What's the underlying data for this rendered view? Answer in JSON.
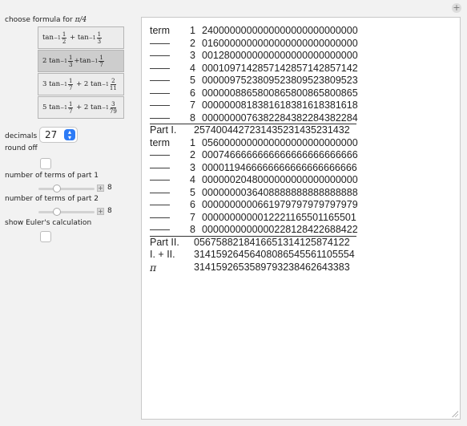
{
  "controls": {
    "choose_formula_label": "choose formula for ",
    "choose_formula_pi": "π/4",
    "formulas": [
      {
        "c1": "",
        "a1": "1",
        "b1": "2",
        "c2": "",
        "a2": "1",
        "b2": "3"
      },
      {
        "c1": "2",
        "a1": "1",
        "b1": "3",
        "c2": "",
        "a2": "1",
        "b2": "7"
      },
      {
        "c1": "3",
        "a1": "1",
        "b1": "7",
        "c2": "2",
        "a2": "2",
        "b2": "11"
      },
      {
        "c1": "5",
        "a1": "1",
        "b1": "7",
        "c2": "2",
        "a2": "3",
        "b2": "79"
      }
    ],
    "selected_formula": 1,
    "decimals_label": "decimals",
    "decimals_value": "27",
    "round_off_label": "round off",
    "part1_label": "number of terms of part 1",
    "part1_value": "8",
    "part1_fraction": 0.3,
    "part2_label": "number of terms of part 2",
    "part2_value": "8",
    "part2_fraction": 0.3,
    "euler_label": "show Euler's calculation"
  },
  "output": {
    "part1_terms": [
      {
        "label": "term",
        "n": "1",
        "value": "2400000000000000000000000000"
      },
      {
        "label": "——",
        "n": "2",
        "value": "0160000000000000000000000000"
      },
      {
        "label": "——",
        "n": "3",
        "value": "0012800000000000000000000000"
      },
      {
        "label": "——",
        "n": "4",
        "value": "0001097142857142857142857142"
      },
      {
        "label": "——",
        "n": "5",
        "value": "0000097523809523809523809523"
      },
      {
        "label": "——",
        "n": "6",
        "value": "0000008865800865800865800865"
      },
      {
        "label": "——",
        "n": "7",
        "value": "0000000818381618381618381618"
      },
      {
        "label": "——",
        "n": "8",
        "value": "0000000076382284382284382284"
      }
    ],
    "part1_sum": {
      "label": "Part I.",
      "value": "2574004427231435231435231432"
    },
    "part2_terms": [
      {
        "label": "term",
        "n": "1",
        "value": "0560000000000000000000000000"
      },
      {
        "label": "——",
        "n": "2",
        "value": "0007466666666666666666666666"
      },
      {
        "label": "——",
        "n": "3",
        "value": "0000119466666666666666666666"
      },
      {
        "label": "——",
        "n": "4",
        "value": "0000002048000000000000000000"
      },
      {
        "label": "——",
        "n": "5",
        "value": "0000000036408888888888888888"
      },
      {
        "label": "——",
        "n": "6",
        "value": "0000000000661979797979797979"
      },
      {
        "label": "——",
        "n": "7",
        "value": "0000000000012221165501165501"
      },
      {
        "label": "——",
        "n": "8",
        "value": "0000000000000228128422688422"
      }
    ],
    "part2_sum": {
      "label": "Part II.",
      "value": "0567588218416651314125874122"
    },
    "total": {
      "label": "I. + II.",
      "value": "3141592645640808654556110555​4"
    },
    "pi": {
      "label": "π",
      "value": "3141592653589793238462643383"
    }
  }
}
